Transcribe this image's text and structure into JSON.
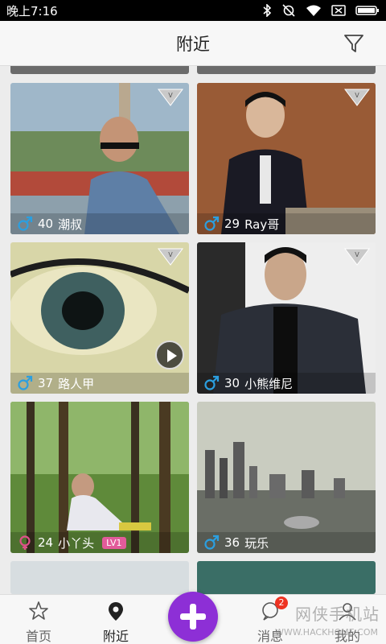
{
  "status": {
    "time": "晚上7:16"
  },
  "header": {
    "title": "附近"
  },
  "cards": [
    {
      "age": "40",
      "name": "潮叔"
    },
    {
      "age": "29",
      "name": "Ray哥"
    },
    {
      "age": "37",
      "name": "路人甲"
    },
    {
      "age": "30",
      "name": "小熊维尼"
    },
    {
      "age": "24",
      "name": "小丫头",
      "level": "LV1"
    },
    {
      "age": "36",
      "name": "玩乐"
    }
  ],
  "nav": {
    "home": "首页",
    "nearby": "附近",
    "messages": "消息",
    "messages_badge": "2",
    "mine": "我的"
  },
  "watermark": {
    "text": "网侠手机站",
    "sub": "WWW.HACKHOME.COM"
  }
}
